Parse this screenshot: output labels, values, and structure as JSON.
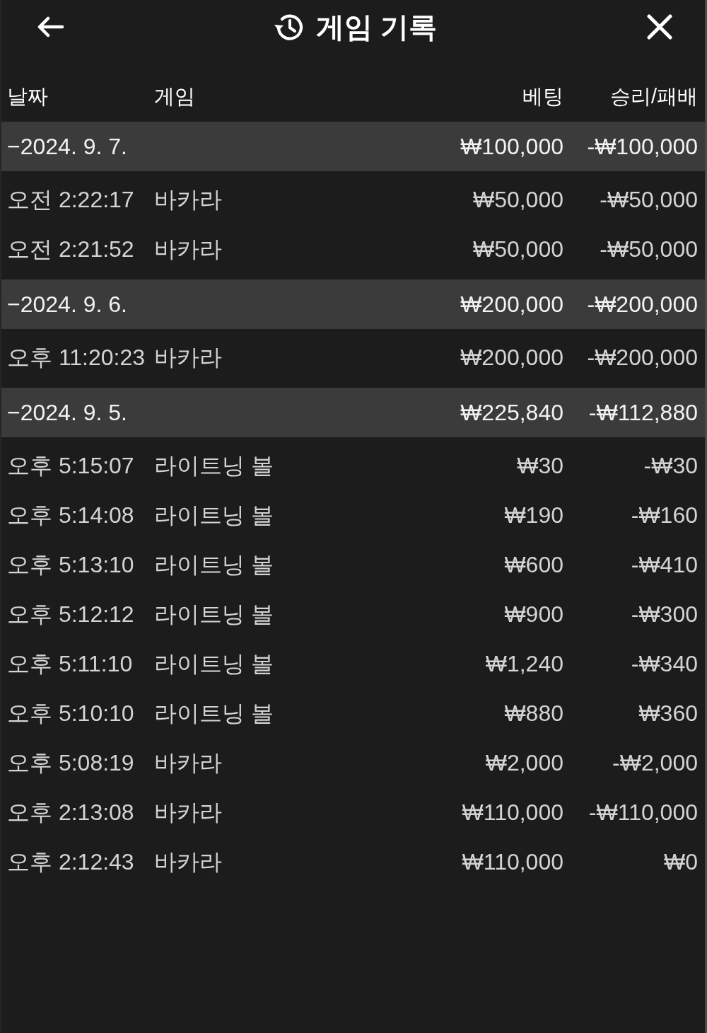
{
  "header": {
    "title": "게임 기록"
  },
  "table": {
    "columns": [
      "날짜",
      "게임",
      "베팅",
      "승리/패배"
    ],
    "groups": [
      {
        "date": "−2024. 9. 7.",
        "bet": "₩100,000",
        "result": "-₩100,000",
        "rows": [
          {
            "time": "오전 2:22:17",
            "game": "바카라",
            "bet": "₩50,000",
            "result": "-₩50,000"
          },
          {
            "time": "오전 2:21:52",
            "game": "바카라",
            "bet": "₩50,000",
            "result": "-₩50,000"
          }
        ]
      },
      {
        "date": "−2024. 9. 6.",
        "bet": "₩200,000",
        "result": "-₩200,000",
        "rows": [
          {
            "time": "오후 11:20:23",
            "game": "바카라",
            "bet": "₩200,000",
            "result": "-₩200,000"
          }
        ]
      },
      {
        "date": "−2024. 9. 5.",
        "bet": "₩225,840",
        "result": "-₩112,880",
        "rows": [
          {
            "time": "오후 5:15:07",
            "game": "라이트닝 볼",
            "bet": "₩30",
            "result": "-₩30"
          },
          {
            "time": "오후 5:14:08",
            "game": "라이트닝 볼",
            "bet": "₩190",
            "result": "-₩160"
          },
          {
            "time": "오후 5:13:10",
            "game": "라이트닝 볼",
            "bet": "₩600",
            "result": "-₩410"
          },
          {
            "time": "오후 5:12:12",
            "game": "라이트닝 볼",
            "bet": "₩900",
            "result": "-₩300"
          },
          {
            "time": "오후 5:11:10",
            "game": "라이트닝 볼",
            "bet": "₩1,240",
            "result": "-₩340"
          },
          {
            "time": "오후 5:10:10",
            "game": "라이트닝 볼",
            "bet": "₩880",
            "result": "₩360"
          },
          {
            "time": "오후 5:08:19",
            "game": "바카라",
            "bet": "₩2,000",
            "result": "-₩2,000"
          },
          {
            "time": "오후 2:13:08",
            "game": "바카라",
            "bet": "₩110,000",
            "result": "-₩110,000"
          },
          {
            "time": "오후 2:12:43",
            "game": "바카라",
            "bet": "₩110,000",
            "result": "₩0"
          }
        ]
      }
    ]
  }
}
